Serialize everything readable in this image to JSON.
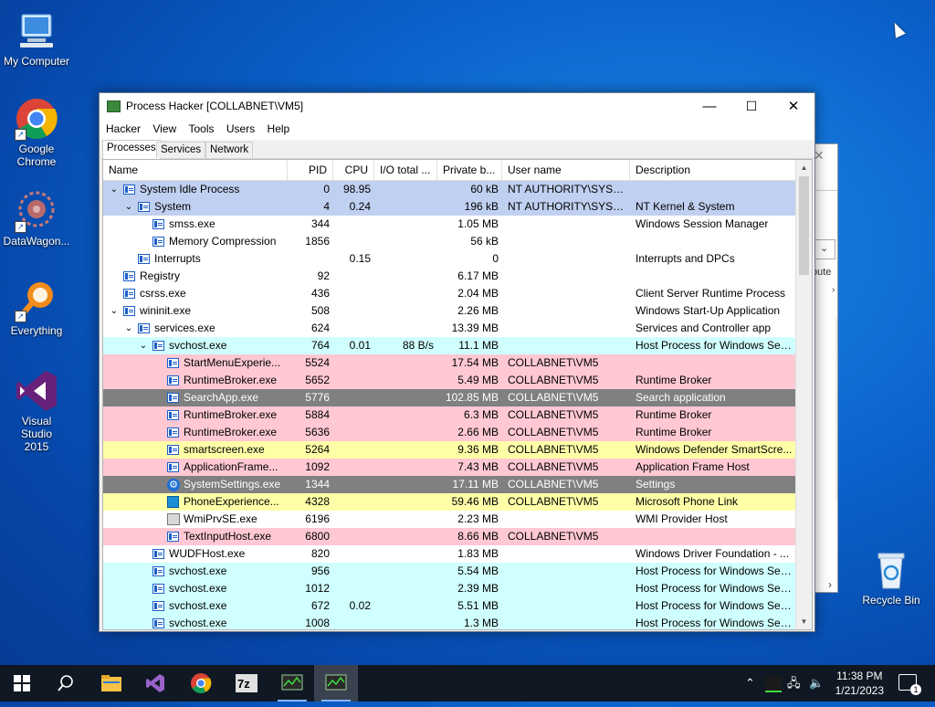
{
  "desktop": {
    "icons": [
      {
        "label": "My Computer",
        "icon": "computer-icon"
      },
      {
        "label": "Google Chrome",
        "icon": "chrome-icon"
      },
      {
        "label": "DataWagon...",
        "icon": "datawagon-icon"
      },
      {
        "label": "Everything",
        "icon": "everything-search-icon"
      },
      {
        "label": "Visual Studio 2015",
        "icon": "visual-studio-icon"
      }
    ],
    "recycle_bin": "Recycle Bin"
  },
  "window": {
    "title": "Process Hacker [COLLABNET\\VM5]",
    "minimize": "—",
    "maximize": "☐",
    "close": "✕",
    "menus": [
      "Hacker",
      "View",
      "Tools",
      "Users",
      "Help"
    ],
    "tabs": [
      "Processes",
      "Services",
      "Network"
    ],
    "active_tab": "Processes"
  },
  "table": {
    "columns": [
      "Name",
      "PID",
      "CPU",
      "I/O total ...",
      "Private b...",
      "User name",
      "Description"
    ],
    "colors": {
      "selected": "#c0d0f0",
      "service": "#d0ffff",
      "own": "#ffc8d3",
      "immersive": "#808080",
      "dotnet": "#ffffa8",
      "normal": "#ffffff"
    },
    "rows": [
      {
        "name": "System Idle Process",
        "pid": "0",
        "cpu": "98.95",
        "io": "",
        "priv": "60 kB",
        "user": "NT AUTHORITY\\SYSTEM",
        "desc": "",
        "level": 0,
        "exp": "v",
        "icon": "process-icon",
        "color": "selected"
      },
      {
        "name": "System",
        "pid": "4",
        "cpu": "0.24",
        "io": "",
        "priv": "196 kB",
        "user": "NT AUTHORITY\\SYSTEM",
        "desc": "NT Kernel & System",
        "level": 1,
        "exp": "v",
        "icon": "process-icon",
        "color": "selected"
      },
      {
        "name": "smss.exe",
        "pid": "344",
        "cpu": "",
        "io": "",
        "priv": "1.05 MB",
        "user": "",
        "desc": "Windows Session Manager",
        "level": 2,
        "exp": "",
        "icon": "process-icon",
        "color": "normal"
      },
      {
        "name": "Memory Compression",
        "pid": "1856",
        "cpu": "",
        "io": "",
        "priv": "56 kB",
        "user": "",
        "desc": "",
        "level": 2,
        "exp": "",
        "icon": "process-icon",
        "color": "normal"
      },
      {
        "name": "Interrupts",
        "pid": "",
        "cpu": "0.15",
        "io": "",
        "priv": "0",
        "user": "",
        "desc": "Interrupts and DPCs",
        "level": 1,
        "exp": "",
        "icon": "process-icon",
        "color": "normal"
      },
      {
        "name": "Registry",
        "pid": "92",
        "cpu": "",
        "io": "",
        "priv": "6.17 MB",
        "user": "",
        "desc": "",
        "level": 0,
        "exp": "",
        "icon": "process-icon",
        "color": "normal"
      },
      {
        "name": "csrss.exe",
        "pid": "436",
        "cpu": "",
        "io": "",
        "priv": "2.04 MB",
        "user": "",
        "desc": "Client Server Runtime Process",
        "level": 0,
        "exp": "",
        "icon": "process-icon",
        "color": "normal"
      },
      {
        "name": "wininit.exe",
        "pid": "508",
        "cpu": "",
        "io": "",
        "priv": "2.26 MB",
        "user": "",
        "desc": "Windows Start-Up Application",
        "level": 0,
        "exp": "v",
        "icon": "process-icon",
        "color": "normal"
      },
      {
        "name": "services.exe",
        "pid": "624",
        "cpu": "",
        "io": "",
        "priv": "13.39 MB",
        "user": "",
        "desc": "Services and Controller app",
        "level": 1,
        "exp": "v",
        "icon": "process-icon",
        "color": "normal"
      },
      {
        "name": "svchost.exe",
        "pid": "764",
        "cpu": "0.01",
        "io": "88 B/s",
        "priv": "11.1 MB",
        "user": "",
        "desc": "Host Process for Windows Ser...",
        "level": 2,
        "exp": "v",
        "icon": "process-icon",
        "color": "service"
      },
      {
        "name": "StartMenuExperie...",
        "pid": "5524",
        "cpu": "",
        "io": "",
        "priv": "17.54 MB",
        "user": "COLLABNET\\VM5",
        "desc": "",
        "level": 3,
        "exp": "",
        "icon": "process-icon",
        "color": "own"
      },
      {
        "name": "RuntimeBroker.exe",
        "pid": "5652",
        "cpu": "",
        "io": "",
        "priv": "5.49 MB",
        "user": "COLLABNET\\VM5",
        "desc": "Runtime Broker",
        "level": 3,
        "exp": "",
        "icon": "process-icon",
        "color": "own"
      },
      {
        "name": "SearchApp.exe",
        "pid": "5776",
        "cpu": "",
        "io": "",
        "priv": "102.85 MB",
        "user": "COLLABNET\\VM5",
        "desc": "Search application",
        "level": 3,
        "exp": "",
        "icon": "process-icon",
        "color": "immersive"
      },
      {
        "name": "RuntimeBroker.exe",
        "pid": "5884",
        "cpu": "",
        "io": "",
        "priv": "6.3 MB",
        "user": "COLLABNET\\VM5",
        "desc": "Runtime Broker",
        "level": 3,
        "exp": "",
        "icon": "process-icon",
        "color": "own"
      },
      {
        "name": "RuntimeBroker.exe",
        "pid": "5636",
        "cpu": "",
        "io": "",
        "priv": "2.66 MB",
        "user": "COLLABNET\\VM5",
        "desc": "Runtime Broker",
        "level": 3,
        "exp": "",
        "icon": "process-icon",
        "color": "own"
      },
      {
        "name": "smartscreen.exe",
        "pid": "5264",
        "cpu": "",
        "io": "",
        "priv": "9.36 MB",
        "user": "COLLABNET\\VM5",
        "desc": "Windows Defender SmartScre...",
        "level": 3,
        "exp": "",
        "icon": "process-icon",
        "color": "dotnet"
      },
      {
        "name": "ApplicationFrame...",
        "pid": "1092",
        "cpu": "",
        "io": "",
        "priv": "7.43 MB",
        "user": "COLLABNET\\VM5",
        "desc": "Application Frame Host",
        "level": 3,
        "exp": "",
        "icon": "process-icon",
        "color": "own"
      },
      {
        "name": "SystemSettings.exe",
        "pid": "1344",
        "cpu": "",
        "io": "",
        "priv": "17.11 MB",
        "user": "COLLABNET\\VM5",
        "desc": "Settings",
        "level": 3,
        "exp": "",
        "icon": "gear-icon",
        "color": "immersive"
      },
      {
        "name": "PhoneExperience...",
        "pid": "4328",
        "cpu": "",
        "io": "",
        "priv": "59.46 MB",
        "user": "COLLABNET\\VM5",
        "desc": "Microsoft Phone Link",
        "level": 3,
        "exp": "",
        "icon": "phone-icon",
        "color": "dotnet"
      },
      {
        "name": "WmiPrvSE.exe",
        "pid": "6196",
        "cpu": "",
        "io": "",
        "priv": "2.23 MB",
        "user": "",
        "desc": "WMI Provider Host",
        "level": 3,
        "exp": "",
        "icon": "wmi-icon",
        "color": "normal"
      },
      {
        "name": "TextInputHost.exe",
        "pid": "6800",
        "cpu": "",
        "io": "",
        "priv": "8.66 MB",
        "user": "COLLABNET\\VM5",
        "desc": "",
        "level": 3,
        "exp": "",
        "icon": "process-icon",
        "color": "own"
      },
      {
        "name": "WUDFHost.exe",
        "pid": "820",
        "cpu": "",
        "io": "",
        "priv": "1.83 MB",
        "user": "",
        "desc": "Windows Driver Foundation - ...",
        "level": 2,
        "exp": "",
        "icon": "process-icon",
        "color": "normal"
      },
      {
        "name": "svchost.exe",
        "pid": "956",
        "cpu": "",
        "io": "",
        "priv": "5.54 MB",
        "user": "",
        "desc": "Host Process for Windows Ser...",
        "level": 2,
        "exp": "",
        "icon": "process-icon",
        "color": "service"
      },
      {
        "name": "svchost.exe",
        "pid": "1012",
        "cpu": "",
        "io": "",
        "priv": "2.39 MB",
        "user": "",
        "desc": "Host Process for Windows Ser...",
        "level": 2,
        "exp": "",
        "icon": "process-icon",
        "color": "service"
      },
      {
        "name": "svchost.exe",
        "pid": "672",
        "cpu": "0.02",
        "io": "",
        "priv": "5.51 MB",
        "user": "",
        "desc": "Host Process for Windows Ser...",
        "level": 2,
        "exp": "",
        "icon": "process-icon",
        "color": "service"
      },
      {
        "name": "svchost.exe",
        "pid": "1008",
        "cpu": "",
        "io": "",
        "priv": "1.3 MB",
        "user": "",
        "desc": "Host Process for Windows Ser...",
        "level": 2,
        "exp": "",
        "icon": "process-icon",
        "color": "service"
      }
    ]
  },
  "background_window": {
    "partial_text": "bute"
  },
  "taskbar": {
    "time": "11:38 PM",
    "date": "1/21/2023",
    "notification_count": "1",
    "apps": [
      "start-icon",
      "search-icon",
      "file-explorer-icon",
      "visual-studio-icon",
      "chrome-icon",
      "7zip-icon",
      "process-hacker-icon",
      "process-hacker-icon"
    ]
  }
}
